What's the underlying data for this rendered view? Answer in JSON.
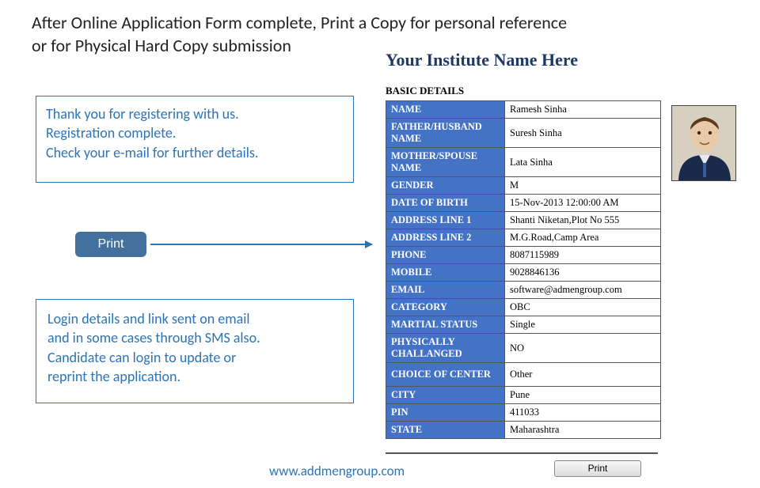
{
  "heading_line1": "After Online Application Form complete, Print a Copy for personal reference",
  "heading_line2": "or for Physical Hard Copy submission",
  "thankyou": {
    "l1": "Thank you for registering with us.",
    "l2": "Registration complete.",
    "l3": "Check your e-mail for further details."
  },
  "print_label": "Print",
  "login_note": {
    "l1": "Login details and link sent on email",
    "l2": "and in some cases through SMS also.",
    "l3": "Candidate can login to update or",
    "l4": "reprint the application."
  },
  "institute_title": "Your Institute Name Here",
  "section_title": "BASIC DETAILS",
  "fields": {
    "name": {
      "label": "NAME",
      "value": "Ramesh Sinha"
    },
    "father": {
      "label": "FATHER/HUSBAND NAME",
      "value": "Suresh Sinha"
    },
    "mother": {
      "label": "MOTHER/SPOUSE NAME",
      "value": "Lata Sinha"
    },
    "gender": {
      "label": "GENDER",
      "value": "M"
    },
    "dob": {
      "label": "DATE OF BIRTH",
      "value": "15-Nov-2013 12:00:00 AM"
    },
    "addr1": {
      "label": "ADDRESS LINE 1",
      "value": "Shanti Niketan,Plot No 555"
    },
    "addr2": {
      "label": "ADDRESS LINE 2",
      "value": "M.G.Road,Camp Area"
    },
    "phone": {
      "label": "PHONE",
      "value": "8087115989"
    },
    "mobile": {
      "label": "MOBILE",
      "value": "9028846136"
    },
    "email": {
      "label": "EMAIL",
      "value": "software@admengroup.com"
    },
    "category": {
      "label": "CATEGORY",
      "value": "OBC"
    },
    "marital": {
      "label": "MARTIAL STATUS",
      "value": "Single"
    },
    "physchal": {
      "label": "PHYSICALLY CHALLANGED",
      "value": "NO"
    },
    "center": {
      "label": "CHOICE OF CENTER",
      "value": "Other"
    },
    "city": {
      "label": "CITY",
      "value": "Pune"
    },
    "pin": {
      "label": "PIN",
      "value": "411033"
    },
    "state": {
      "label": "STATE",
      "value": "Maharashtra"
    }
  },
  "bottom_print_label": "Print",
  "site_url": "www.addmengroup.com"
}
